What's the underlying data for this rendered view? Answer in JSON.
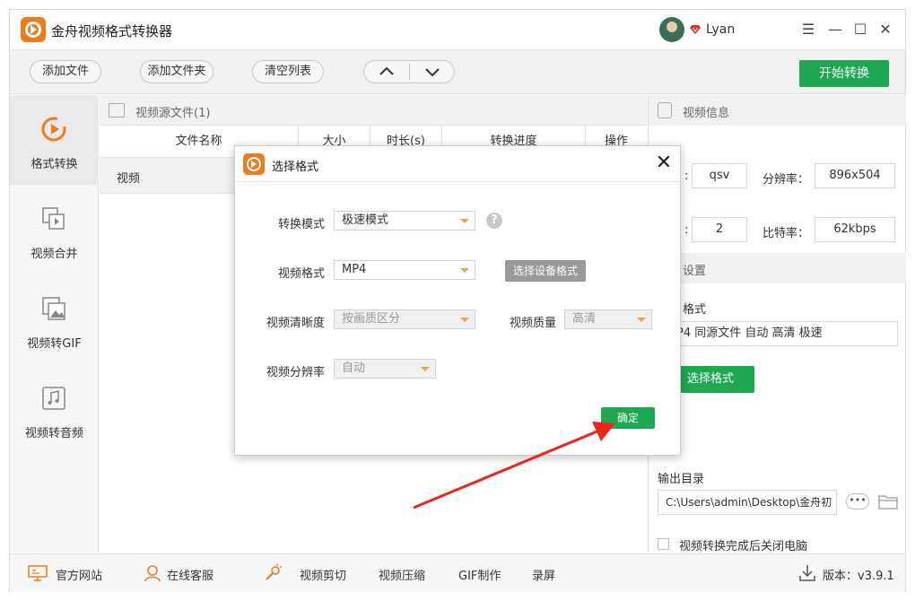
{
  "app": {
    "title": "金舟视频格式转换器"
  },
  "user": {
    "name": "Lyan"
  },
  "window_controls": {
    "menu": "☰",
    "minimize": "—",
    "maximize": "☐",
    "close": "✕"
  },
  "toolbar": {
    "add_file": "添加文件",
    "add_folder": "添加文件夹",
    "clear_list": "清空列表",
    "move_up": "︿",
    "move_down": "﹀",
    "start": "开始转换"
  },
  "sidebar": {
    "items": [
      {
        "label": "格式转换",
        "active": true
      },
      {
        "label": "视频合并"
      },
      {
        "label": "视频转GIF"
      },
      {
        "label": "视频转音频"
      }
    ]
  },
  "file_list": {
    "header": "视频源文件(1)",
    "columns": [
      "文件名称",
      "大小",
      "时长(s)",
      "转换进度",
      "操作"
    ],
    "rows": [
      {
        "name": "视频"
      }
    ]
  },
  "video_info": {
    "header": "视频信息",
    "codec_value": "qsv",
    "resolution_label": "分辨率：",
    "resolution_value": "896x504",
    "row2_value": "2",
    "bitrate_label": "比特率：",
    "bitrate_value": "62kbps"
  },
  "output_settings": {
    "header": "设置",
    "format_label": "格式",
    "format_summary": "P4 同源文件 自动 高清 极速",
    "select_format_button": "选择格式",
    "output_dir_label": "输出目录",
    "output_dir_value": "C:\\Users\\admin\\Desktop\\金舟初",
    "more_button": "•••",
    "shutdown_checkbox_label": "视频转换完成后关闭电脑"
  },
  "bottom_bar": {
    "website": "官方网站",
    "support": "在线客服",
    "video_edit": "视频剪切",
    "video_compress": "视频压缩",
    "gif_make": "GIF制作",
    "screen_record": "录屏",
    "version": "版本：v3.9.1"
  },
  "dialog": {
    "title": "选择格式",
    "close": "✕",
    "convert_mode_label": "转换模式",
    "convert_mode_value": "极速模式",
    "video_format_label": "视频格式",
    "video_format_value": "MP4",
    "device_format_button": "选择设备格式",
    "clarity_label": "视频清晰度",
    "clarity_value": "按画质区分",
    "quality_label": "视频质量",
    "quality_value": "高清",
    "resolution_label": "视频分辨率",
    "resolution_value": "自动",
    "help": "?",
    "ok_button": "确定"
  },
  "colors": {
    "accent_green": "#1ea852",
    "logo_orange": "#f07a1c",
    "annotation_red": "#e8271f"
  }
}
